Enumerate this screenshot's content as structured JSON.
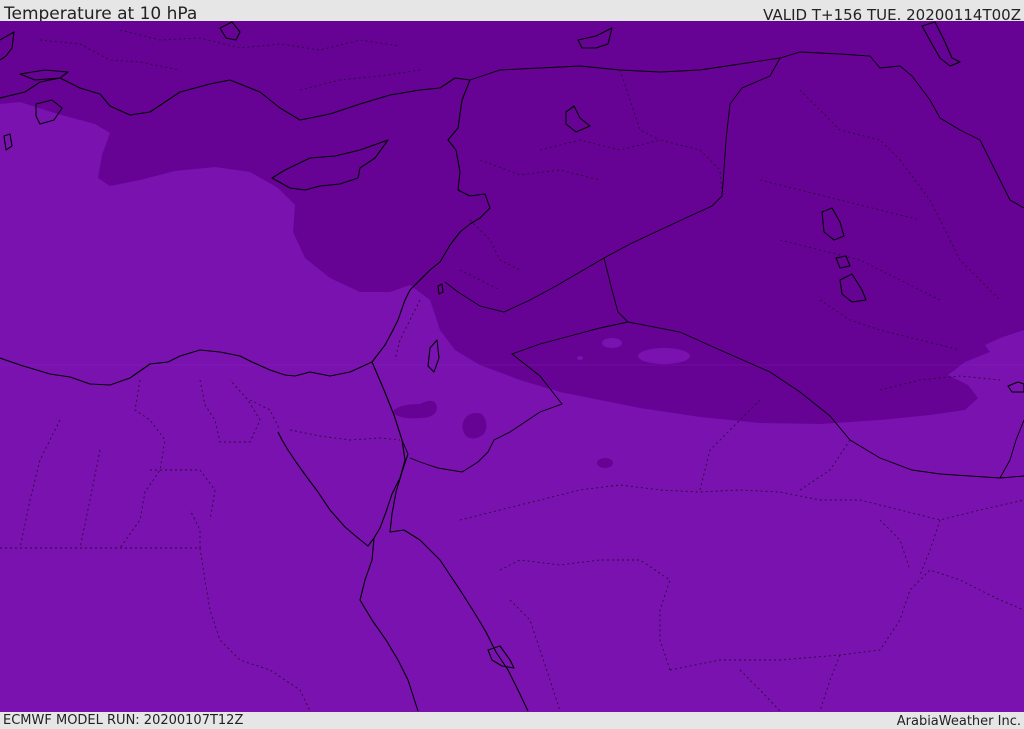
{
  "header": {
    "title": "Temperature at 10 hPa",
    "valid_time": "VALID T+156 TUE. 20200114T00Z"
  },
  "footer": {
    "model_run": "ECMWF MODEL RUN: 20200107T12Z",
    "provider": "ArabiaWeather Inc."
  },
  "map": {
    "colors": {
      "warmer_band": "#7a12b0",
      "colder_band": "#660394",
      "coast_line": "#000000",
      "border_line": "#2a0a3a"
    }
  }
}
